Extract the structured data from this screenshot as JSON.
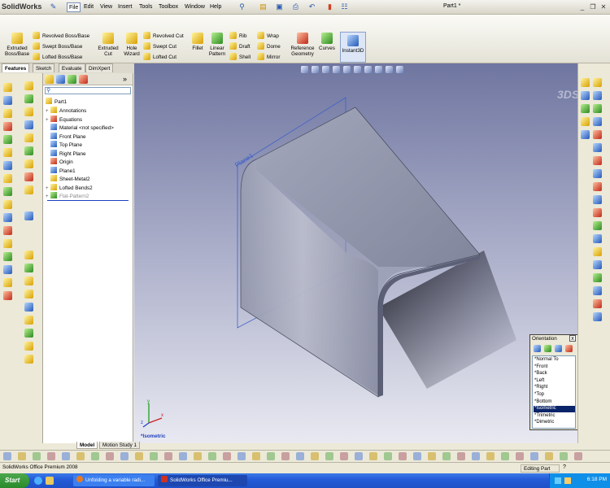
{
  "titlebar": {
    "logo_brand": "Solid",
    "logo_suffix": "Works",
    "doc_title": "Part1 *",
    "menu": [
      "File",
      "Edit",
      "View",
      "Insert",
      "Tools",
      "Toolbox",
      "Window",
      "Help"
    ]
  },
  "command_manager": {
    "extruded_boss": "Extruded Boss/Base",
    "revolved_boss": "Revolved Boss/Base",
    "swept_boss": "Swept Boss/Base",
    "lofted_boss": "Lofted Boss/Base",
    "extruded_cut": "Extruded Cut",
    "hole_wizard": "Hole Wizard",
    "revolved_cut": "Revolved Cut",
    "swept_cut": "Swept Cut",
    "lofted_cut": "Lofted Cut",
    "fillet": "Fillet",
    "linear_pattern": "Linear Pattern",
    "rib": "Rib",
    "draft": "Draft",
    "shell": "Shell",
    "wrap": "Wrap",
    "dome": "Dome",
    "mirror": "Mirror",
    "reference_geometry": "Reference Geometry",
    "curves": "Curves",
    "instant3d": "Instant3D"
  },
  "tabs": [
    "Features",
    "Sketch",
    "Evaluate",
    "DimXpert"
  ],
  "tree": {
    "root": "Part1",
    "nodes": [
      {
        "label": "Annotations",
        "icon": "annotations-icon",
        "expander": "+"
      },
      {
        "label": "Equations",
        "icon": "equations-icon",
        "expander": "+"
      },
      {
        "label": "Material <not specified>",
        "icon": "material-icon",
        "expander": ""
      },
      {
        "label": "Front Plane",
        "icon": "plane-icon",
        "expander": ""
      },
      {
        "label": "Top Plane",
        "icon": "plane-icon",
        "expander": ""
      },
      {
        "label": "Right Plane",
        "icon": "plane-icon",
        "expander": ""
      },
      {
        "label": "Origin",
        "icon": "origin-icon",
        "expander": ""
      },
      {
        "label": "Plane1",
        "icon": "plane-icon",
        "expander": ""
      },
      {
        "label": "Sheet-Metal2",
        "icon": "sheet-metal-icon",
        "expander": ""
      },
      {
        "label": "Lofted Bends2",
        "icon": "lofted-bends-icon",
        "expander": "+"
      },
      {
        "label": "Flat-Pattern2",
        "icon": "flat-pattern-icon",
        "expander": "+"
      }
    ]
  },
  "viewport": {
    "plane_label": "Plane1",
    "view_label": "*Isometric",
    "triad_x": "x",
    "triad_y": "y",
    "triad_z": "z"
  },
  "orientation": {
    "title": "Orientation",
    "close": "x",
    "items": [
      "*Normal To",
      "*Front",
      "*Back",
      "*Left",
      "*Right",
      "*Top",
      "*Bottom",
      "*Isometric",
      "*Trimetric",
      "*Dimetric"
    ],
    "selected_index": 7
  },
  "bottom_tabs": [
    "Model",
    "Motion Study 1"
  ],
  "status": {
    "text": "SolidWorks Office Premium 2008",
    "mode": "Editing Part"
  },
  "taskbar": {
    "start": "Start",
    "tasks": [
      "Unfolding a variable radi...",
      "SolidWorks Office Premiu..."
    ],
    "clock": "6:18 PM"
  },
  "colors": {
    "part_face": "#9499ad",
    "viewport_top": "#6f76a0",
    "viewport_bottom": "#e8e9f1",
    "selection": "#0a246a",
    "taskbar": "#245cd8"
  }
}
